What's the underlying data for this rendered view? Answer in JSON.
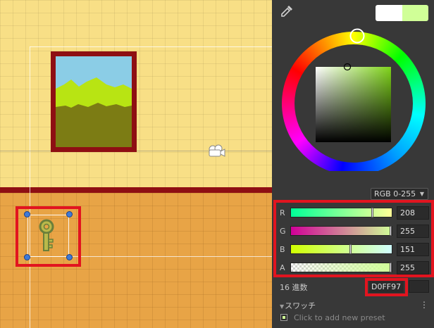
{
  "color_picker": {
    "mode": "RGB 0-255",
    "channels": [
      {
        "label": "R",
        "value": "208",
        "level": 0.816
      },
      {
        "label": "G",
        "value": "255",
        "level": 1.0
      },
      {
        "label": "B",
        "value": "151",
        "level": 0.592
      },
      {
        "label": "A",
        "value": "255",
        "level": 1.0
      }
    ],
    "hex_label": "16 進数",
    "hex_value": "D0FF97",
    "swatches_label": "スワッチ",
    "preset_hint": "Click to add new preset",
    "previous_color": "#ffffff",
    "current_color": "#d0ff97"
  },
  "icons": {
    "eyedropper": "eyedropper-icon",
    "camera": "camera-icon",
    "key": "key-icon",
    "menu": "more-vertical-icon"
  }
}
